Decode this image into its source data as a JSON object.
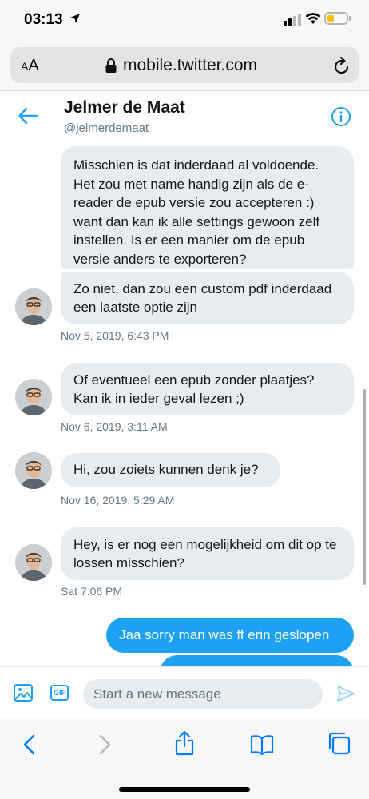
{
  "status_bar": {
    "time": "03:13",
    "battery_level": 0.35,
    "battery_color": "#f5c400"
  },
  "browser": {
    "text_size_label": "AA",
    "url": "mobile.twitter.com",
    "icons": [
      "lock-icon",
      "reload-icon"
    ]
  },
  "dm_header": {
    "name": "Jelmer de Maat",
    "handle": "@jelmerdemaat",
    "icons": [
      "back-arrow-icon",
      "info-icon"
    ],
    "accent": "#1da1f2"
  },
  "messages": [
    {
      "direction": "in",
      "text": "Misschien is dat inderdaad al voldoende. Het zou met name handig zijn als de e-reader de epub versie zou accepteren :) want dan kan ik alle settings gewoon zelf instellen. Is er een manier om de epub versie anders te exporteren?"
    },
    {
      "direction": "in",
      "text": "Zo niet, dan zou een custom pdf inderdaad een laatste optie zijn"
    },
    {
      "direction": "in",
      "text": "Of eventueel een epub zonder plaatjes? Kan ik in ieder geval lezen ;)"
    },
    {
      "direction": "in",
      "text": "Hi, zou zoiets kunnen denk je?"
    },
    {
      "direction": "in",
      "text": "Hey, is er nog een mogelijkheid om dit op te lossen misschien?"
    },
    {
      "direction": "out",
      "text": "Jaa sorry man was ff erin geslopen"
    },
    {
      "direction": "out",
      "text": ""
    }
  ],
  "timestamps": [
    "Nov 5, 2019, 6:43 PM",
    "Nov 6, 2019, 3:11 AM",
    "Nov 16, 2019, 5:29 AM",
    "Sat 7:06 PM"
  ],
  "composer": {
    "placeholder": "Start a new message",
    "gif_label": "GIF",
    "icons": [
      "image-icon",
      "gif-icon",
      "send-icon"
    ]
  },
  "toolbar": {
    "icons": [
      "back-icon",
      "forward-icon",
      "share-icon",
      "bookmarks-icon",
      "tabs-icon"
    ]
  },
  "colors": {
    "incoming_bubble": "#e6ecf0",
    "outgoing_bubble": "#1da1f2",
    "secondary_text": "#657786",
    "ios_blue": "#007aff"
  }
}
